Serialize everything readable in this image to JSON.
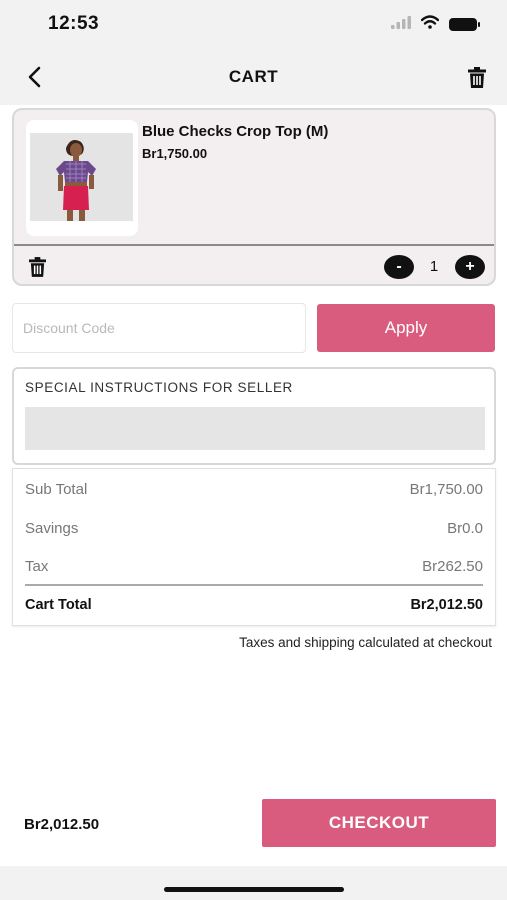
{
  "status_bar": {
    "time": "12:53",
    "icons": [
      "signal-icon",
      "wifi-icon",
      "battery-icon"
    ]
  },
  "nav": {
    "title": "CART",
    "back_icon": "chevron-left-icon",
    "trash_icon": "trash-icon"
  },
  "cart_item": {
    "name": "Blue Checks Crop Top (M)",
    "price": "Br1,750.00",
    "quantity": "1",
    "minus_label": "-",
    "plus_label": "+"
  },
  "discount": {
    "placeholder": "Discount Code",
    "value": "",
    "apply_label": "Apply"
  },
  "instructions": {
    "label": "SPECIAL INSTRUCTIONS FOR SELLER",
    "value": ""
  },
  "totals": {
    "rows": [
      {
        "label": "Sub Total",
        "value": "Br1,750.00"
      },
      {
        "label": "Savings",
        "value": "Br0.0"
      },
      {
        "label": "Tax",
        "value": "Br262.50"
      }
    ],
    "total_label": "Cart Total",
    "total_value": "Br2,012.50"
  },
  "tax_note": "Taxes and shipping calculated at checkout",
  "bottom": {
    "total": "Br2,012.50",
    "checkout_label": "CHECKOUT"
  },
  "colors": {
    "accent": "#d95c7f",
    "item_bg": "#f3eef0",
    "bar_bg": "#f2f2f2"
  }
}
